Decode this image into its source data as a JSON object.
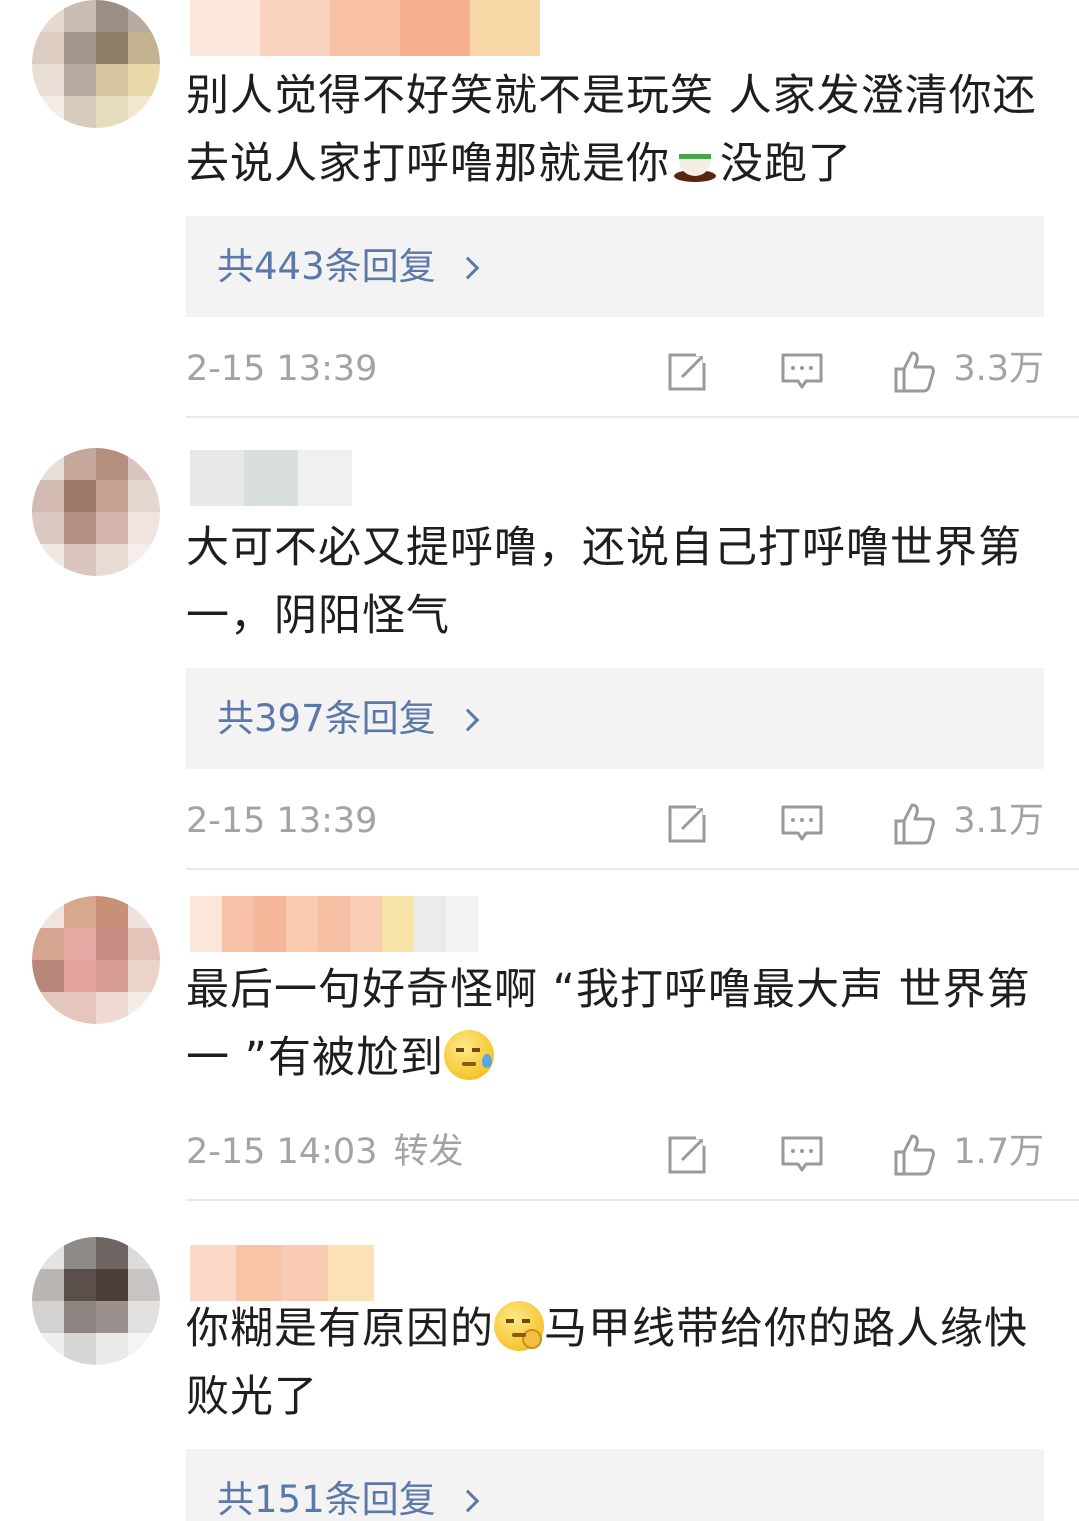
{
  "comments": [
    {
      "text_before_emoji": "别人觉得不好笑就不是玩笑 人家发澄清你还去说人家打呼噜那就是你",
      "emoji": "tea-cup-emoji",
      "text_after_emoji": "没跑了",
      "replies_label": "共443条回复",
      "timestamp": "2-15 13:39",
      "repost_label": "",
      "likes": "3.3万"
    },
    {
      "text_before_emoji": "大可不必又提呼噜，还说自己打呼噜世界第一，阴阳怪气",
      "emoji": "",
      "text_after_emoji": "",
      "replies_label": "共397条回复",
      "timestamp": "2-15 13:39",
      "repost_label": "",
      "likes": "3.1万"
    },
    {
      "text_before_emoji": "最后一句好奇怪啊 “我打呼噜最大声 世界第一 ”有被尬到",
      "emoji": "sweat-face-emoji",
      "text_after_emoji": "",
      "replies_label": "",
      "timestamp": "2-15 14:03",
      "repost_label": "转发",
      "likes": "1.7万"
    },
    {
      "text_before_emoji": "你糊是有原因的",
      "emoji": "thinking-face-emoji",
      "text_after_emoji": "马甲线带给你的路人缘快败光了",
      "replies_label": "共151条回复",
      "timestamp": "",
      "repost_label": "",
      "likes": ""
    }
  ],
  "icons": {
    "edit": "edit-icon",
    "comment": "comment-icon",
    "like": "thumbs-up-icon"
  },
  "colors": {
    "link": "#5b78a8",
    "meta_gray": "#a3a3a3",
    "reply_box_bg": "#f3f3f3",
    "divider": "#e9e9e9"
  }
}
